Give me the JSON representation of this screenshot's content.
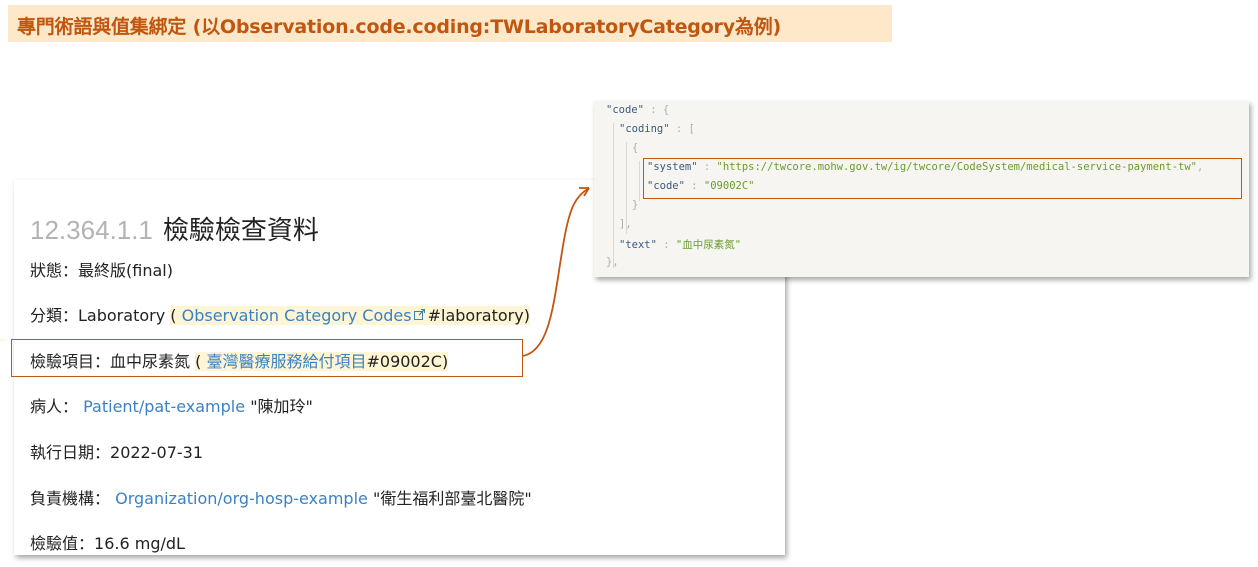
{
  "banner": {
    "title": "專門術語與值集綁定 (以Observation.code.coding:TWLaboratoryCategory為例)"
  },
  "resource": {
    "heading_number": "12.364.1.1",
    "heading_title": "檢驗檢查資料",
    "status_label": "狀態：",
    "status_value": "最終版(final)",
    "category_label": "分類：",
    "category_value": "Laboratory",
    "category_open": "(",
    "category_link": "Observation Category Codes",
    "category_code": "#laboratory",
    "category_close": ")",
    "item_label": "檢驗項目：",
    "item_value": "血中尿素氮",
    "item_open": "(",
    "item_link": "臺灣醫療服務給付項目",
    "item_code": "#09002C",
    "item_close": ")",
    "patient_label": "病人：",
    "patient_link": "Patient/pat-example",
    "patient_name": "\"陳加玲\"",
    "date_label": "執行日期：",
    "date_value": "2022-07-31",
    "org_label": "負責機構：",
    "org_link": "Organization/org-hosp-example",
    "org_name": "\"衛生福利部臺北醫院\"",
    "value_label": "檢驗值：",
    "value_value": "16.6 mg/dL",
    "ext_icon": "external-link-icon"
  },
  "json_snippet": {
    "code_key": "\"code\"",
    "coding_key": "\"coding\"",
    "system_key": "\"system\"",
    "system_value": "\"https://twcore.mohw.gov.tw/ig/twcore/CodeSystem/medical-service-payment-tw\"",
    "code_inner_key": "\"code\"",
    "code_inner_value": "\"09002C\"",
    "text_key": "\"text\"",
    "text_value": "\"血中尿素氮\"",
    "p_colon_brace": " : {",
    "p_colon_bracket": " : [",
    "p_open_brace": "{",
    "p_colon": " : ",
    "p_comma": ",",
    "p_close_brace": "}",
    "p_close_bracket": "],",
    "p_close_brace_comma": "},"
  },
  "colors": {
    "accent": "#c0560f",
    "banner_bg": "#fde9c9",
    "link": "#3b82c4",
    "json_string": "#6a9d2b"
  }
}
